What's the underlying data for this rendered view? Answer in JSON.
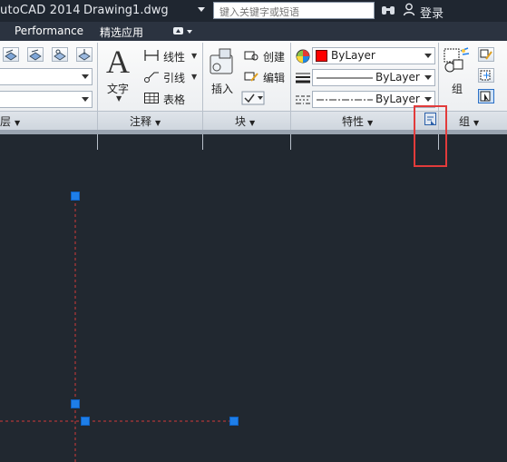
{
  "titlebar": {
    "app_title": "utoCAD 2014",
    "document": "Drawing1.dwg",
    "search_placeholder": "键入关键字或短语",
    "login_label": "登录"
  },
  "tabs": {
    "performance": "Performance",
    "featured": "精选应用"
  },
  "annotation": {
    "text_label": "文字",
    "linear_label": "线性",
    "leader_label": "引线",
    "table_label": "表格",
    "panel_title": "注释"
  },
  "block": {
    "insert_label": "插入",
    "create_label": "创建",
    "edit_label": "编辑",
    "panel_title": "块"
  },
  "properties": {
    "color_value": "ByLayer",
    "linetype_value": "ByLayer",
    "lineweight_value": "ByLayer",
    "panel_title": "特性",
    "color_swatch": "#ff0000"
  },
  "groups": {
    "group_label": "组",
    "panel_title": "组"
  },
  "left_panel": {
    "panel_title_fragment": "层"
  },
  "colors": {
    "canvas_bg": "#212830",
    "grip": "#1e7ee8",
    "dashed_line": "#d23a3a",
    "highlight": "#e23b3b"
  }
}
